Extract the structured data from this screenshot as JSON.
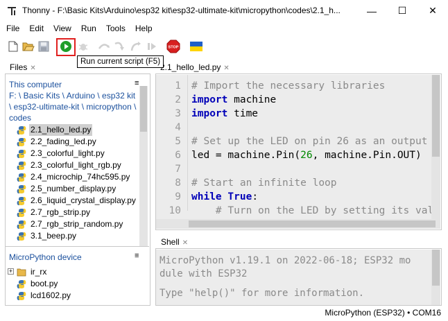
{
  "window": {
    "title": "Thonny  -  F:\\Basic Kits\\Arduino\\esp32 kit\\esp32-ultimate-kit\\micropython\\codes\\2.1_h...",
    "minimize": "—",
    "maximize": "☐",
    "close": "✕"
  },
  "menu": [
    "File",
    "Edit",
    "View",
    "Run",
    "Tools",
    "Help"
  ],
  "toolbar": {
    "tooltip": "Run current script (F5)",
    "stop_label": "STOP",
    "colors": {
      "run": "#1e9e2a",
      "stop": "#d81f1f",
      "flag_blue": "#1f5fc8",
      "flag_yellow": "#ffd400",
      "highlight": "#e0201f"
    }
  },
  "files": {
    "tab_label": "Files",
    "this_computer": "This computer",
    "path": "F: \\ Basic Kits \\ Arduino \\ esp32 kit \\ esp32-ultimate-kit \\ micropython \\ codes",
    "items": [
      "2.1_hello_led.py",
      "2.2_fading_led.py",
      "2.3_colorful_light.py",
      "2.3_colorful_light_rgb.py",
      "2.4_microchip_74hc595.py",
      "2.5_number_display.py",
      "2.6_liquid_crystal_display.py",
      "2.7_rgb_strip.py",
      "2.7_rgb_strip_random.py",
      "3.1_beep.py"
    ],
    "selected": "2.1_hello_led.py"
  },
  "device": {
    "title": "MicroPython device",
    "items": [
      "ir_rx",
      "boot.py",
      "lcd1602.py"
    ]
  },
  "editor": {
    "tab_label": "2.1_hello_led.py",
    "line_numbers": [
      "1",
      "2",
      "3",
      "4",
      "5",
      "6",
      "7",
      "8",
      "9",
      "10"
    ],
    "lines": [
      "# Import the necessary libraries",
      "import machine",
      "import time",
      "",
      "# Set up the LED on pin 26 as an output",
      "led = machine.Pin(26, machine.Pin.OUT)",
      "",
      "# Start an infinite loop",
      "while True:",
      "    # Turn on the LED by setting its value"
    ]
  },
  "shell": {
    "tab_label": "Shell",
    "lines": [
      "MicroPython v1.19.1 on 2022-06-18; ESP32 mo",
      "dule with ESP32",
      "",
      "Type \"help()\" for more information."
    ]
  },
  "status": {
    "text": "MicroPython (ESP32)  •  COM16"
  }
}
